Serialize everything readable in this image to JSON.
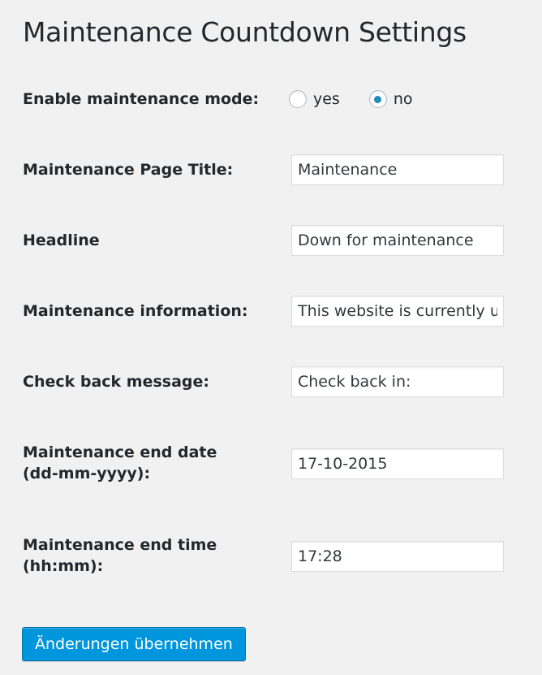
{
  "page": {
    "title": "Maintenance Countdown Settings"
  },
  "form": {
    "enable_mode": {
      "label": "Enable maintenance mode:",
      "options": [
        {
          "label": "yes",
          "selected": false
        },
        {
          "label": "no",
          "selected": true
        }
      ]
    },
    "page_title": {
      "label": "Maintenance Page Title:",
      "value": "Maintenance"
    },
    "headline": {
      "label": "Headline",
      "value": "Down for maintenance"
    },
    "information": {
      "label": "Maintenance information:",
      "value": "This website is currently u"
    },
    "check_back": {
      "label": "Check back message:",
      "value": "Check back in:"
    },
    "end_date": {
      "label": "Maintenance end date (dd-mm-yyyy):",
      "value": "17-10-2015"
    },
    "end_time": {
      "label": "Maintenance end time (hh:mm):",
      "value": "17:28"
    }
  },
  "actions": {
    "submit_label": "Änderungen übernehmen"
  },
  "colors": {
    "background": "#f1f1f1",
    "primary_button": "#0096dd",
    "radio_selected": "#1e8cbe"
  }
}
